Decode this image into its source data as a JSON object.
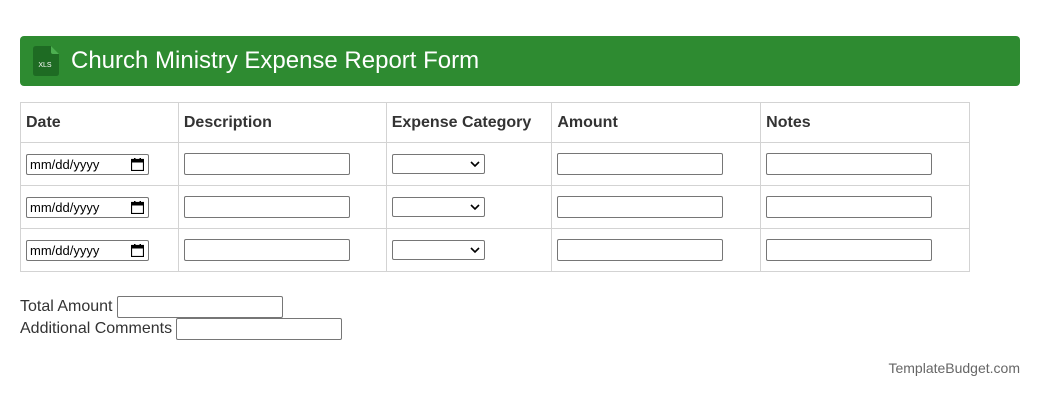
{
  "header": {
    "icon": "xls-file-icon",
    "icon_label": "XLS",
    "title": "Church Ministry Expense Report Form",
    "color": "#2e8b31"
  },
  "table": {
    "columns": [
      "Date",
      "Description",
      "Expense Category",
      "Amount",
      "Notes"
    ],
    "rows": [
      {
        "date_placeholder": "mm/dd/yyyy",
        "description": "",
        "category": "",
        "amount": "",
        "notes": ""
      },
      {
        "date_placeholder": "mm/dd/yyyy",
        "description": "",
        "category": "",
        "amount": "",
        "notes": ""
      },
      {
        "date_placeholder": "mm/dd/yyyy",
        "description": "",
        "category": "",
        "amount": "",
        "notes": ""
      }
    ]
  },
  "summary": {
    "total_label": "Total Amount",
    "total_value": "",
    "comments_label": "Additional Comments",
    "comments_value": ""
  },
  "footer": {
    "brand": "TemplateBudget.com"
  }
}
